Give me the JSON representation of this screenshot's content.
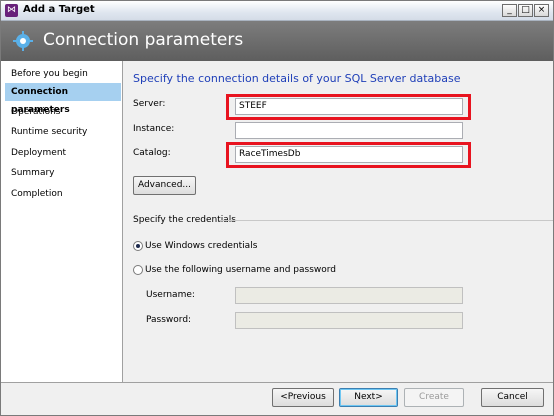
{
  "window": {
    "title": "Add a Target",
    "app_icon": "visual-studio-icon",
    "controls": {
      "minimize": "_",
      "maximize": "□",
      "close": "×"
    }
  },
  "header": {
    "title": "Connection parameters",
    "icon": "gear-wizard-icon"
  },
  "sidebar": {
    "items": [
      {
        "label": "Before you begin",
        "active": false
      },
      {
        "label": "Connection parameters",
        "active": true
      },
      {
        "label": "Operations",
        "active": false
      },
      {
        "label": "Runtime security",
        "active": false
      },
      {
        "label": "Deployment",
        "active": false
      },
      {
        "label": "Summary",
        "active": false
      },
      {
        "label": "Completion",
        "active": false
      }
    ]
  },
  "main": {
    "heading": "Specify the connection details of your SQL Server database",
    "server": {
      "label": "Server:",
      "value": "STEEF"
    },
    "instance": {
      "label": "Instance:",
      "value": ""
    },
    "catalog": {
      "label": "Catalog:",
      "value": "RaceTimesDb"
    },
    "advanced_button": "Advanced...",
    "credentials_group": "Specify the credentials",
    "radio_windows": {
      "label": "Use Windows credentials",
      "selected": true
    },
    "radio_userpass": {
      "label": "Use the following username and password",
      "selected": false
    },
    "username": {
      "label": "Username:",
      "value": ""
    },
    "password": {
      "label": "Password:",
      "value": ""
    }
  },
  "footer": {
    "previous": "<Previous",
    "next": "Next>",
    "create": "Create",
    "cancel": "Cancel"
  },
  "colors": {
    "highlight": "#e8131f",
    "heading": "#1f3fb8",
    "active_nav": "#a6d0f0"
  }
}
